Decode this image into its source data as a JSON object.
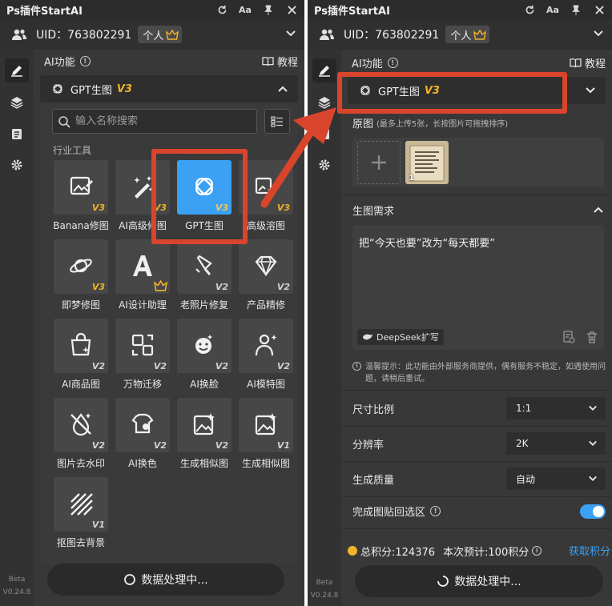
{
  "app_title": "Ps插件StartAI",
  "titlebar_font_label": "Aa",
  "uid_label": "UID：763802291",
  "account_badge": "个人",
  "section_title": "AI功能",
  "tutorial_label": "教程",
  "selected_tool": {
    "name": "GPT生图",
    "version": "V3"
  },
  "search": {
    "placeholder": "输入名称搜索"
  },
  "category_label": "行业工具",
  "tools": [
    {
      "label": "Banana修图",
      "version": "V3",
      "icon": "image-edit-icon"
    },
    {
      "label": "AI高级修图",
      "version": "V3",
      "icon": "magic-wand-icon"
    },
    {
      "label": "GPT生图",
      "version": "V3",
      "icon": "gpt-logo-icon",
      "selected": true
    },
    {
      "label": "高级溶图",
      "version": "V3",
      "icon": "blend-sparkle-icon"
    },
    {
      "label": "即梦修图",
      "version": "V3",
      "icon": "planet-icon"
    },
    {
      "label": "AI设计助理",
      "version": "crown",
      "icon": "letter-a-icon"
    },
    {
      "label": "老照片修复",
      "version": "V2",
      "icon": "brush-icon"
    },
    {
      "label": "产品精修",
      "version": "V2",
      "icon": "diamond-icon"
    },
    {
      "label": "AI商品图",
      "version": "V2",
      "icon": "shopping-bag-icon"
    },
    {
      "label": "万物迁移",
      "version": "V2",
      "icon": "transfer-icon"
    },
    {
      "label": "AI换脸",
      "version": "V2",
      "icon": "face-icon"
    },
    {
      "label": "AI模特图",
      "version": "V2",
      "icon": "model-icon"
    },
    {
      "label": "图片去水印",
      "version": "V2",
      "icon": "no-watermark-icon"
    },
    {
      "label": "AI换色",
      "version": "V2",
      "icon": "palette-icon"
    },
    {
      "label": "生成相似图",
      "version": "V2",
      "icon": "similar-image-icon"
    },
    {
      "label": "生成相似图",
      "version": "V1",
      "icon": "similar-image-icon"
    },
    {
      "label": "抠图去背景",
      "version": "V1",
      "icon": "cutout-icon"
    }
  ],
  "processing_button": "数据处理中...",
  "beta_label": "Beta",
  "version_label": "V0.24.8",
  "source_image": {
    "label": "原图",
    "hint": "(最多上传5张，长按图片可拖拽排序)",
    "count": "1"
  },
  "prompt_section": {
    "label": "生图需求",
    "text": "把“今天也要”改为“每天都要”",
    "deepseek_button": "DeepSeek扩写"
  },
  "warning_text": "温馨提示：此功能由外部服务商提供，偶有服务不稳定，如遇使用问题，请稍后重试。",
  "settings": {
    "aspect_label": "尺寸比例",
    "aspect_value": "1:1",
    "resolution_label": "分辨率",
    "resolution_value": "2K",
    "quality_label": "生成质量",
    "quality_value": "自动",
    "paste_label": "完成图贴回选区"
  },
  "points": {
    "total": "总积分:124376",
    "estimate": "本次预计:100积分",
    "get_label": "获取积分"
  },
  "colors": {
    "accent": "#3aa1f5",
    "gold": "#f0b429",
    "highlight": "#d9452c"
  }
}
